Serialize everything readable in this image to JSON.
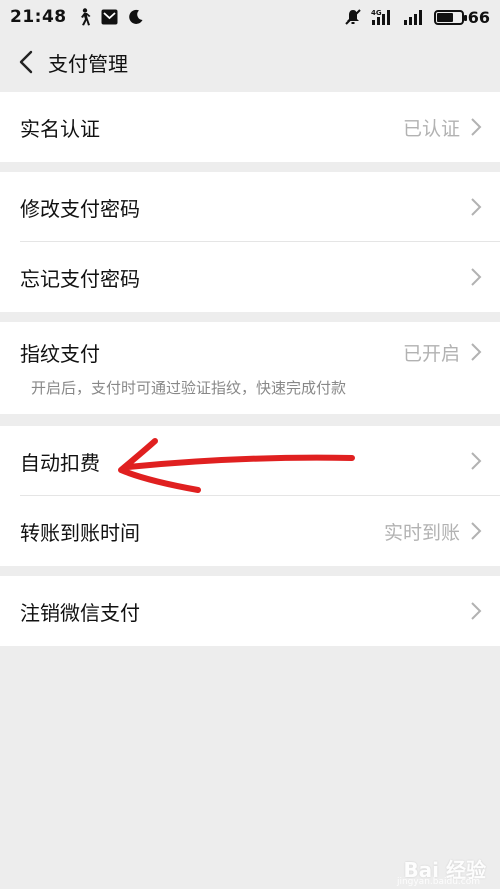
{
  "status_bar": {
    "time": "21:48",
    "network": "4G",
    "battery": "66",
    "battery_level": 0.66
  },
  "nav": {
    "title": "支付管理"
  },
  "groups": [
    {
      "rows": [
        {
          "label": "实名认证",
          "value": "已认证"
        }
      ]
    },
    {
      "rows": [
        {
          "label": "修改支付密码",
          "value": ""
        },
        {
          "label": "忘记支付密码",
          "value": ""
        }
      ]
    },
    {
      "rows": [
        {
          "label": "指纹支付",
          "value": "已开启",
          "desc": "开启后，支付时可通过验证指纹，快速完成付款"
        }
      ]
    },
    {
      "rows": [
        {
          "label": "自动扣费",
          "value": ""
        },
        {
          "label": "转账到账时间",
          "value": "实时到账"
        }
      ]
    },
    {
      "rows": [
        {
          "label": "注销微信支付",
          "value": ""
        }
      ]
    }
  ],
  "annotation": {
    "color": "#e02020"
  },
  "watermark": {
    "text": "Bai 经验",
    "sub": "jingyan.baidu.com"
  }
}
